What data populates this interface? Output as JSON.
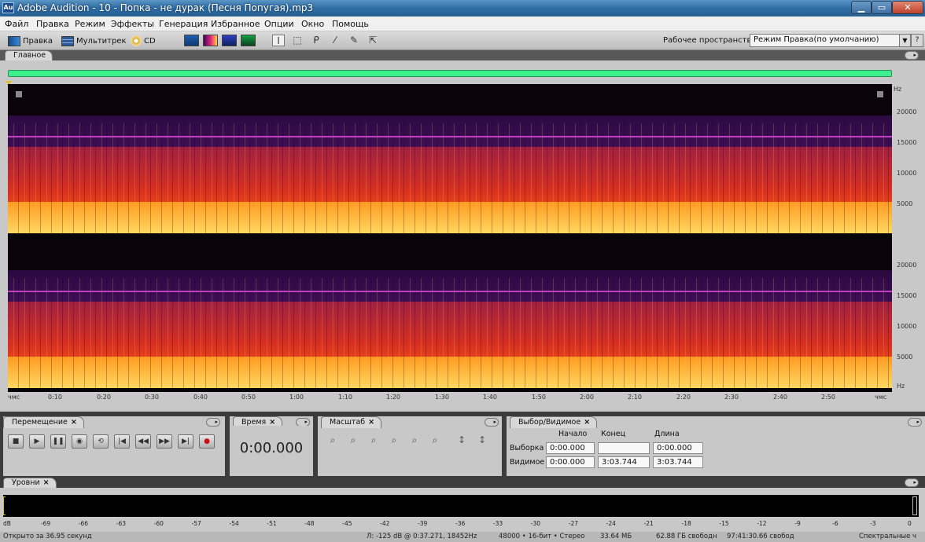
{
  "window": {
    "app_icon": "Au",
    "title": "Adobe Audition - 10 - Попка - не дурак (Песня Попугая).mp3"
  },
  "menu": [
    "Файл",
    "Правка",
    "Режим",
    "Эффекты",
    "Генерация",
    "Избранное",
    "Опции",
    "Окно",
    "Помощь"
  ],
  "toolbar": {
    "edit_label": "Правка",
    "multitrack_label": "Мультитрек",
    "cd_label": "CD",
    "workspace_label": "Рабочее пространство:",
    "workspace_value": "Режим Правка(по умолчанию)"
  },
  "editor": {
    "tab": "Главное",
    "freq_unit": "Hz",
    "freq_ticks": [
      "20000",
      "15000",
      "10000",
      "5000"
    ],
    "freq_ticks_bottom": [
      "20000",
      "15000",
      "10000",
      "5000",
      "Hz"
    ],
    "time_ticks": [
      "чмс",
      "0:10",
      "0:20",
      "0:30",
      "0:40",
      "0:50",
      "1:00",
      "1:10",
      "1:20",
      "1:30",
      "1:40",
      "1:50",
      "2:00",
      "2:10",
      "2:20",
      "2:30",
      "2:40",
      "2:50",
      "чмс"
    ]
  },
  "transport": {
    "tab": "Перемещение",
    "buttons": [
      "■",
      "▶",
      "❚❚",
      "◉",
      "⟲",
      "|◀",
      "◀◀",
      "▶▶",
      "▶|",
      "●"
    ]
  },
  "time_panel": {
    "tab": "Время",
    "value": "0:00.000"
  },
  "zoom_panel": {
    "tab": "Масштаб",
    "buttons": [
      "⌕",
      "⌕",
      "⌕",
      "⌕",
      "⌕",
      "⌕",
      "↕",
      "↕"
    ]
  },
  "selection_panel": {
    "tab": "Выбор/Видимое",
    "col_start": "Начало",
    "col_end": "Конец",
    "col_length": "Длина",
    "row_selection": "Выборка",
    "row_view": "Видимое",
    "sel_start": "0:00.000",
    "sel_end": "",
    "sel_length": "0:00.000",
    "view_start": "0:00.000",
    "view_end": "3:03.744",
    "view_length": "3:03.744"
  },
  "levels": {
    "tab": "Уровни",
    "scale": [
      "dB",
      "-69",
      "-66",
      "-63",
      "-60",
      "-57",
      "-54",
      "-51",
      "-48",
      "-45",
      "-42",
      "-39",
      "-36",
      "-33",
      "-30",
      "-27",
      "-24",
      "-21",
      "-18",
      "-15",
      "-12",
      "-9",
      "-6",
      "-3",
      "0"
    ]
  },
  "status": {
    "opened": "Открыто за 36.95 секунд",
    "cursor": "Л: -125 dB @ 0:37.271, 18452Hz",
    "format": "48000 • 16-бит • Стерео",
    "size": "33.64 МБ",
    "free": "62.88 ГБ свободн",
    "free_time": "97:41:30.66 свобод",
    "view": "Спектральные ч"
  },
  "colors": {
    "overview": "#3df08e",
    "spectrum_hot": "#ffd860",
    "spectrum_cold": "#3a0a5a",
    "accent_line": "#c040c0"
  }
}
